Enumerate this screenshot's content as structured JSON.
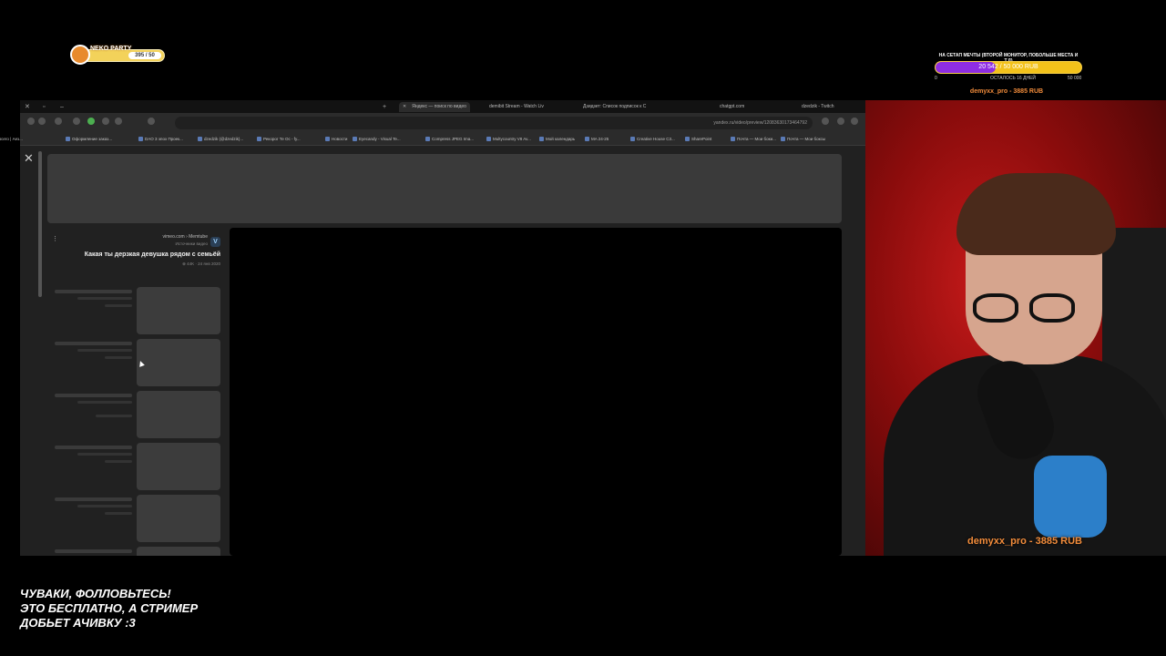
{
  "level_widget": {
    "name": "NEKO PARTY",
    "value": "395 / 50"
  },
  "goal": {
    "title": "НА СЕТАП МЕЧТЫ (ВТОРОЙ МОНИТОР, ПОБОЛЬШЕ МЕСТА И Т.Д)",
    "progress_text": "20 542 / 50 000 RUB",
    "progress": 0.41,
    "min": "0",
    "remaining": "ОСТАЛОСЬ 16 ДНЕЙ",
    "max": "50 000",
    "fill_color": "#8e2de2",
    "bar_color": "#f3c21b"
  },
  "donor_top": "demyxx_pro - 3885 RUB",
  "browser": {
    "tabs": [
      {
        "label": "Яндекс — поиск по видео",
        "active": true
      },
      {
        "label": "demibit Stream - Watch Liv"
      },
      {
        "label": "Дзидзет: Список подписок к С"
      },
      {
        "label": "chatgpt.com"
      },
      {
        "label": "dzedzik - Twitch"
      }
    ],
    "url": "yandex.ru/video/preview/12083630173464792",
    "bookmarks": [
      "Почта — Мои боксы",
      "Почта — Мои боки...",
      "SharePoint",
      "Creative House C3...",
      "MA 24-25",
      "Мой календарь",
      "Multycountry V8 Av...",
      "Compress JPEG Ima...",
      "Eyecandy - Visual Te...",
      "Новости",
      "Рекорог Те Ос - fy...",
      "dzedzik (@dzedzik)...",
      "DAO 3 эпох Проек...",
      "Оформление заказ...",
      "корзина всего | Аез..."
    ],
    "video": {
      "source": "vimeo.com › Memtube",
      "source_sub": "Источники видео",
      "title": "Какая ты дерзкая девушка рядом с семьёй",
      "meta": "⊕ 44K · 24 янв 2020",
      "vimeo_badge": "V"
    }
  },
  "donor_cam": "demyxx_pro - 3885 RUB",
  "follow_text": [
    "ЧУВАКИ, ФОЛЛОВЬТЕСЬ!",
    "ЭТО БЕСПЛАТНО, А СТРИМЕР",
    "ДОБЬЕТ АЧИВКУ :3"
  ]
}
